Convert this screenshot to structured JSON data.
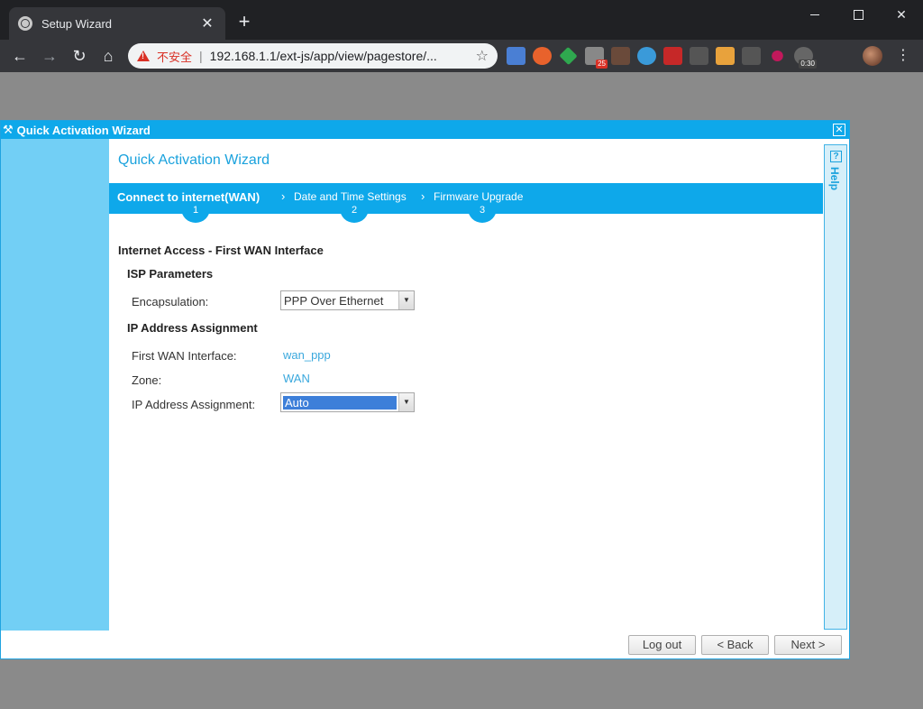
{
  "browser": {
    "tab_title": "Setup Wizard",
    "tab_close": "✕",
    "new_tab": "+",
    "security_label": "不安全",
    "url": "192.168.1.1/ext-js/app/view/pagestore/...",
    "ext_badge_mail": "25",
    "ext_badge_timer": "0:30"
  },
  "dialog": {
    "header_title": "Quick Activation Wizard",
    "main_title": "Quick Activation Wizard",
    "steps": [
      {
        "label": "Connect to internet(WAN)",
        "number": "1"
      },
      {
        "label": "Date and Time Settings",
        "number": "2"
      },
      {
        "label": "Firmware Upgrade",
        "number": "3"
      }
    ],
    "section_title": "Internet Access - First WAN Interface",
    "isp_heading": "ISP Parameters",
    "encapsulation_label": "Encapsulation:",
    "encapsulation_value": "PPP Over Ethernet",
    "ip_heading": "IP Address Assignment",
    "first_wan_label": "First WAN Interface:",
    "first_wan_value": "wan_ppp",
    "zone_label": "Zone:",
    "zone_value": "WAN",
    "ip_assign_label": "IP Address Assignment:",
    "ip_assign_value": "Auto",
    "help_label": "Help",
    "buttons": {
      "logout": "Log out",
      "back": "< Back",
      "next": "Next >"
    }
  },
  "colors": {
    "accent": "#0ea8ea",
    "left_panel": "#72cff5",
    "value_text": "#3aa8dd"
  }
}
